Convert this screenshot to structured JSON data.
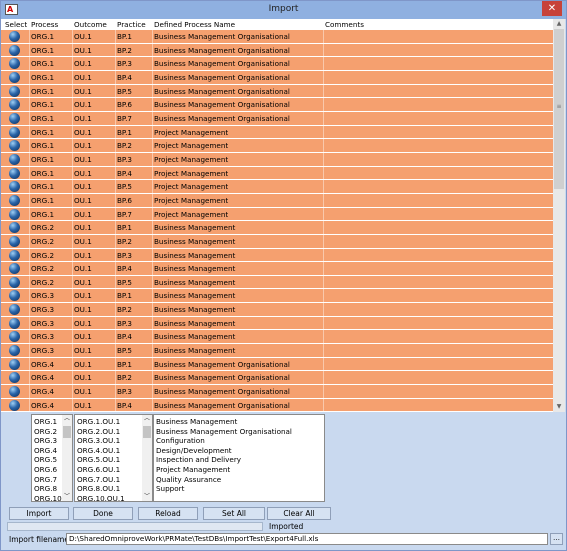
{
  "window": {
    "title": "Import",
    "close_glyph": "✕",
    "icon_letter": "A"
  },
  "table": {
    "columns": [
      "Select",
      "Process",
      "Outcome",
      "Practice",
      "Defined Process Name",
      "Comments"
    ],
    "rows": [
      {
        "process": "ORG.1",
        "outcome": "OU.1",
        "practice": "BP.1",
        "name": "Business Management Organisational",
        "comments": ""
      },
      {
        "process": "ORG.1",
        "outcome": "OU.1",
        "practice": "BP.2",
        "name": "Business Management Organisational",
        "comments": ""
      },
      {
        "process": "ORG.1",
        "outcome": "OU.1",
        "practice": "BP.3",
        "name": "Business Management Organisational",
        "comments": ""
      },
      {
        "process": "ORG.1",
        "outcome": "OU.1",
        "practice": "BP.4",
        "name": "Business Management Organisational",
        "comments": ""
      },
      {
        "process": "ORG.1",
        "outcome": "OU.1",
        "practice": "BP.5",
        "name": "Business Management Organisational",
        "comments": ""
      },
      {
        "process": "ORG.1",
        "outcome": "OU.1",
        "practice": "BP.6",
        "name": "Business Management Organisational",
        "comments": ""
      },
      {
        "process": "ORG.1",
        "outcome": "OU.1",
        "practice": "BP.7",
        "name": "Business Management Organisational",
        "comments": ""
      },
      {
        "process": "ORG.1",
        "outcome": "OU.1",
        "practice": "BP.1",
        "name": "Project Management",
        "comments": ""
      },
      {
        "process": "ORG.1",
        "outcome": "OU.1",
        "practice": "BP.2",
        "name": "Project Management",
        "comments": ""
      },
      {
        "process": "ORG.1",
        "outcome": "OU.1",
        "practice": "BP.3",
        "name": "Project Management",
        "comments": ""
      },
      {
        "process": "ORG.1",
        "outcome": "OU.1",
        "practice": "BP.4",
        "name": "Project Management",
        "comments": ""
      },
      {
        "process": "ORG.1",
        "outcome": "OU.1",
        "practice": "BP.5",
        "name": "Project Management",
        "comments": ""
      },
      {
        "process": "ORG.1",
        "outcome": "OU.1",
        "practice": "BP.6",
        "name": "Project Management",
        "comments": ""
      },
      {
        "process": "ORG.1",
        "outcome": "OU.1",
        "practice": "BP.7",
        "name": "Project Management",
        "comments": ""
      },
      {
        "process": "ORG.2",
        "outcome": "OU.1",
        "practice": "BP.1",
        "name": "Business Management",
        "comments": ""
      },
      {
        "process": "ORG.2",
        "outcome": "OU.1",
        "practice": "BP.2",
        "name": "Business Management",
        "comments": ""
      },
      {
        "process": "ORG.2",
        "outcome": "OU.1",
        "practice": "BP.3",
        "name": "Business Management",
        "comments": ""
      },
      {
        "process": "ORG.2",
        "outcome": "OU.1",
        "practice": "BP.4",
        "name": "Business Management",
        "comments": ""
      },
      {
        "process": "ORG.2",
        "outcome": "OU.1",
        "practice": "BP.5",
        "name": "Business Management",
        "comments": ""
      },
      {
        "process": "ORG.3",
        "outcome": "OU.1",
        "practice": "BP.1",
        "name": "Business Management",
        "comments": ""
      },
      {
        "process": "ORG.3",
        "outcome": "OU.1",
        "practice": "BP.2",
        "name": "Business Management",
        "comments": ""
      },
      {
        "process": "ORG.3",
        "outcome": "OU.1",
        "practice": "BP.3",
        "name": "Business Management",
        "comments": ""
      },
      {
        "process": "ORG.3",
        "outcome": "OU.1",
        "practice": "BP.4",
        "name": "Business Management",
        "comments": ""
      },
      {
        "process": "ORG.3",
        "outcome": "OU.1",
        "practice": "BP.5",
        "name": "Business Management",
        "comments": ""
      },
      {
        "process": "ORG.4",
        "outcome": "OU.1",
        "practice": "BP.1",
        "name": "Business Management Organisational",
        "comments": ""
      },
      {
        "process": "ORG.4",
        "outcome": "OU.1",
        "practice": "BP.2",
        "name": "Business Management Organisational",
        "comments": ""
      },
      {
        "process": "ORG.4",
        "outcome": "OU.1",
        "practice": "BP.3",
        "name": "Business Management Organisational",
        "comments": ""
      },
      {
        "process": "ORG.4",
        "outcome": "OU.1",
        "practice": "BP.4",
        "name": "Business Management Organisational",
        "comments": ""
      }
    ]
  },
  "filters": {
    "processes": [
      "ORG.1",
      "ORG.2",
      "ORG.3",
      "ORG.4",
      "ORG.5",
      "ORG.6",
      "ORG.7",
      "ORG.8",
      "ORG.10"
    ],
    "outcomes": [
      "ORG.1.OU.1",
      "ORG.2.OU.1",
      "ORG.3.OU.1",
      "ORG.4.OU.1",
      "ORG.5.OU.1",
      "ORG.6.OU.1",
      "ORG.7.OU.1",
      "ORG.8.OU.1",
      "ORG.10.OU.1"
    ],
    "defined_processes": [
      "Business Management",
      "Business Management Organisational",
      "Configuration",
      "Design/Development",
      "Inspection and Delivery",
      "Project Management",
      "Quality Assurance",
      "Support"
    ]
  },
  "buttons": {
    "import": "Import",
    "done": "Done",
    "reload": "Reload",
    "set_all": "Set All",
    "clear_all": "Clear All"
  },
  "status": {
    "text": "Imported"
  },
  "import_file": {
    "label": "Import filename",
    "value": "D:\\SharedOmniproveWork\\PRMate\\TestDBs\\ImportTest\\Export4Full.xls",
    "browse_glyph": "…"
  },
  "colors": {
    "row_bg": "#f5a06f",
    "window_bg": "#c9d9ef",
    "titlebar": "#8fb0e0",
    "close": "#c7423a"
  },
  "icons": {
    "select_marker": "blue-ball-icon"
  }
}
